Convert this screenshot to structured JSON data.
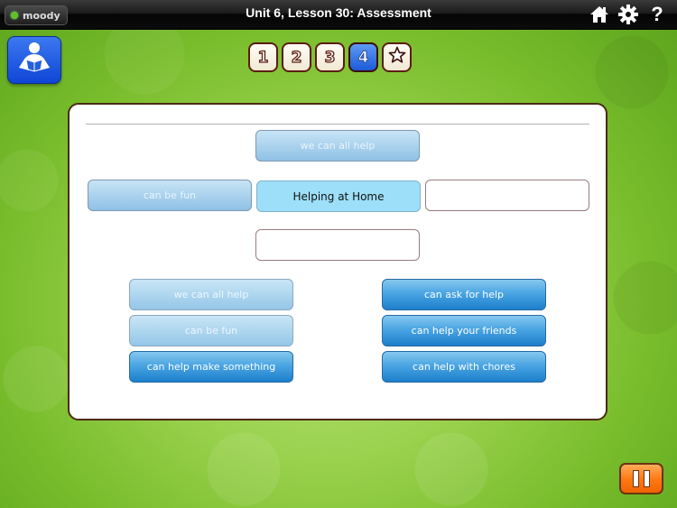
{
  "header": {
    "user_name": "moody",
    "user_status_color": "#5fc324",
    "title": "Unit 6, Lesson 30: Assessment",
    "icons": [
      "home-icon",
      "gear-icon",
      "help-icon"
    ]
  },
  "reader_button": {
    "icon": "reading-person-icon"
  },
  "pager": {
    "pages": [
      {
        "label": "1",
        "active": false
      },
      {
        "label": "2",
        "active": false
      },
      {
        "label": "3",
        "active": false
      },
      {
        "label": "4",
        "active": true
      },
      {
        "label": "☆",
        "active": false
      }
    ]
  },
  "web": {
    "center": "Helping at Home",
    "top": "we can all help",
    "left": "can be fun",
    "right": "",
    "bottom": ""
  },
  "choices": {
    "left": [
      {
        "label": "we can all help",
        "used": true
      },
      {
        "label": "can be fun",
        "used": true
      },
      {
        "label": "can help make something",
        "used": false
      }
    ],
    "right": [
      {
        "label": "can ask for help",
        "used": false
      },
      {
        "label": "can help your friends",
        "used": false
      },
      {
        "label": "can help with chores",
        "used": false
      }
    ]
  },
  "pause_button": {
    "icon": "pause-icon",
    "color": "#ff7a14"
  }
}
